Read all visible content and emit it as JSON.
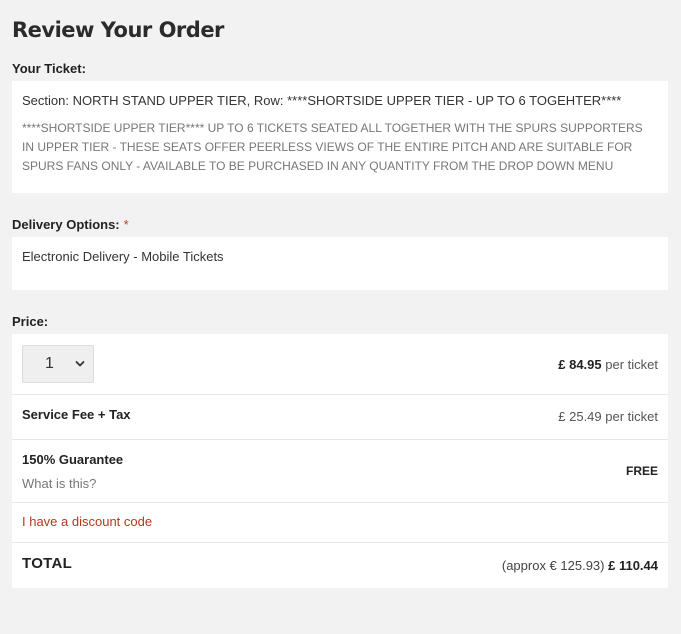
{
  "page": {
    "title": "Review Your Order"
  },
  "ticket": {
    "label": "Your Ticket:",
    "section_row": "Section: NORTH STAND UPPER TIER, Row: ****SHORTSIDE UPPER TIER - UP TO 6 TOGEHTER****",
    "description": "****SHORTSIDE UPPER TIER**** UP TO 6 TICKETS SEATED ALL TOGETHER WITH THE SPURS SUPPORTERS IN UPPER TIER - THESE SEATS OFFER PEERLESS VIEWS OF THE ENTIRE PITCH AND ARE SUITABLE FOR SPURS FANS ONLY - AVAILABLE TO BE PURCHASED IN ANY QUANTITY FROM THE DROP DOWN MENU"
  },
  "delivery": {
    "label": "Delivery Options:",
    "required_marker": "*",
    "selected": "Electronic Delivery - Mobile Tickets"
  },
  "price": {
    "label": "Price:",
    "quantity": "1",
    "ticket_price": "£ 84.95",
    "per_ticket": "per ticket",
    "fee_label": "Service Fee + Tax",
    "fee_value": "£ 25.49 per ticket",
    "guarantee_label": "150% Guarantee",
    "guarantee_link": "What is this?",
    "guarantee_value": "FREE",
    "discount_link": "I have a discount code",
    "total_label": "TOTAL",
    "total_approx": "(approx € 125.93)",
    "total_value": "£ 110.44"
  },
  "colors": {
    "background": "#f2f2f2",
    "panel": "#ffffff",
    "required": "#c0392b",
    "discount_link": "#b03a1f"
  },
  "icons": {
    "quantity_dropdown": "chevron-down-icon"
  }
}
